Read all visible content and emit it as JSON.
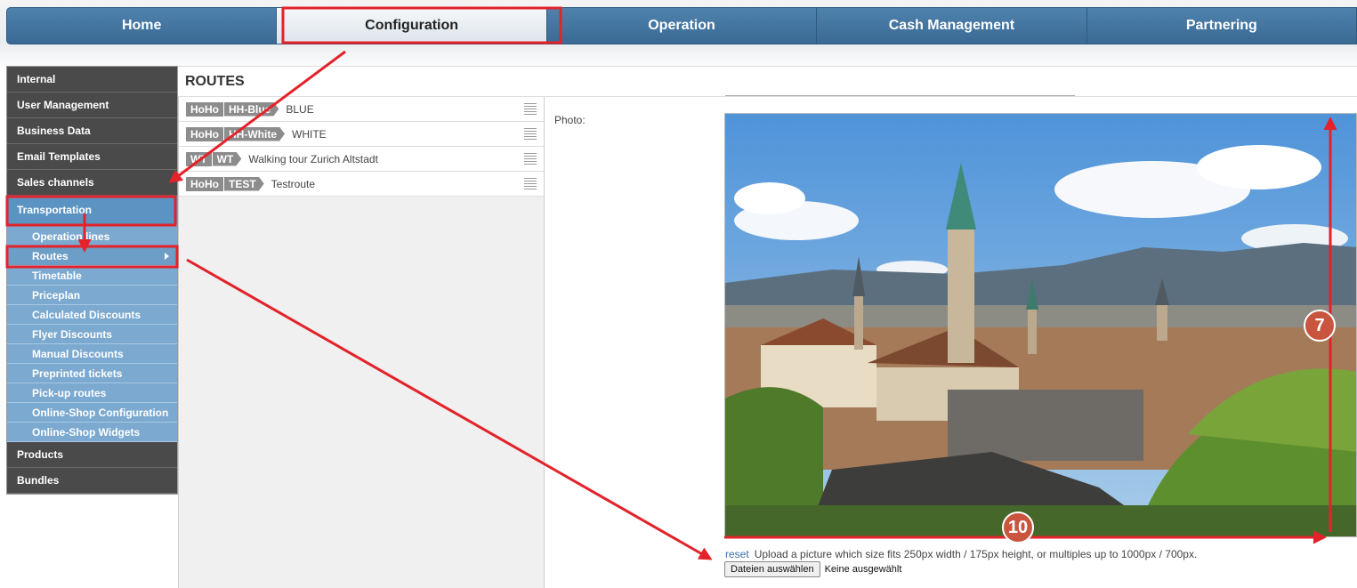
{
  "topnav": {
    "items": [
      {
        "label": "Home"
      },
      {
        "label": "Configuration"
      },
      {
        "label": "Operation"
      },
      {
        "label": "Cash Management"
      },
      {
        "label": "Partnering"
      }
    ]
  },
  "sidebar": {
    "main_top": [
      "Internal",
      "User Management",
      "Business Data",
      "Email Templates",
      "Sales channels"
    ],
    "open_item": "Transportation",
    "sub_items": [
      "Operation lines",
      "Routes",
      "Timetable",
      "Priceplan",
      "Calculated Discounts",
      "Flyer Discounts",
      "Manual Discounts",
      "Preprinted tickets",
      "Pick-up routes",
      "Online-Shop Configuration",
      "Online-Shop Widgets"
    ],
    "main_bottom": [
      "Products",
      "Bundles"
    ]
  },
  "panel": {
    "title": "ROUTES"
  },
  "routes": [
    {
      "tag1": "HoHo",
      "tag2": "HH-Blue",
      "name": "BLUE"
    },
    {
      "tag1": "HoHo",
      "tag2": "HH-White",
      "name": "WHITE"
    },
    {
      "tag1": "WT",
      "tag2": "WT",
      "name": "Walking tour Zurich Altstadt"
    },
    {
      "tag1": "HoHo",
      "tag2": "TEST",
      "name": "Testroute"
    }
  ],
  "detail": {
    "photo_label": "Photo:",
    "reset_label": "reset",
    "upload_hint": "Upload a picture which size fits 250px width / 175px height, or multiples up to 1000px / 700px.",
    "file_button": "Dateien auswählen",
    "file_status": "Keine ausgewählt"
  },
  "annotations": {
    "badge_height": "7",
    "badge_width": "10",
    "color": "#e3222a"
  }
}
